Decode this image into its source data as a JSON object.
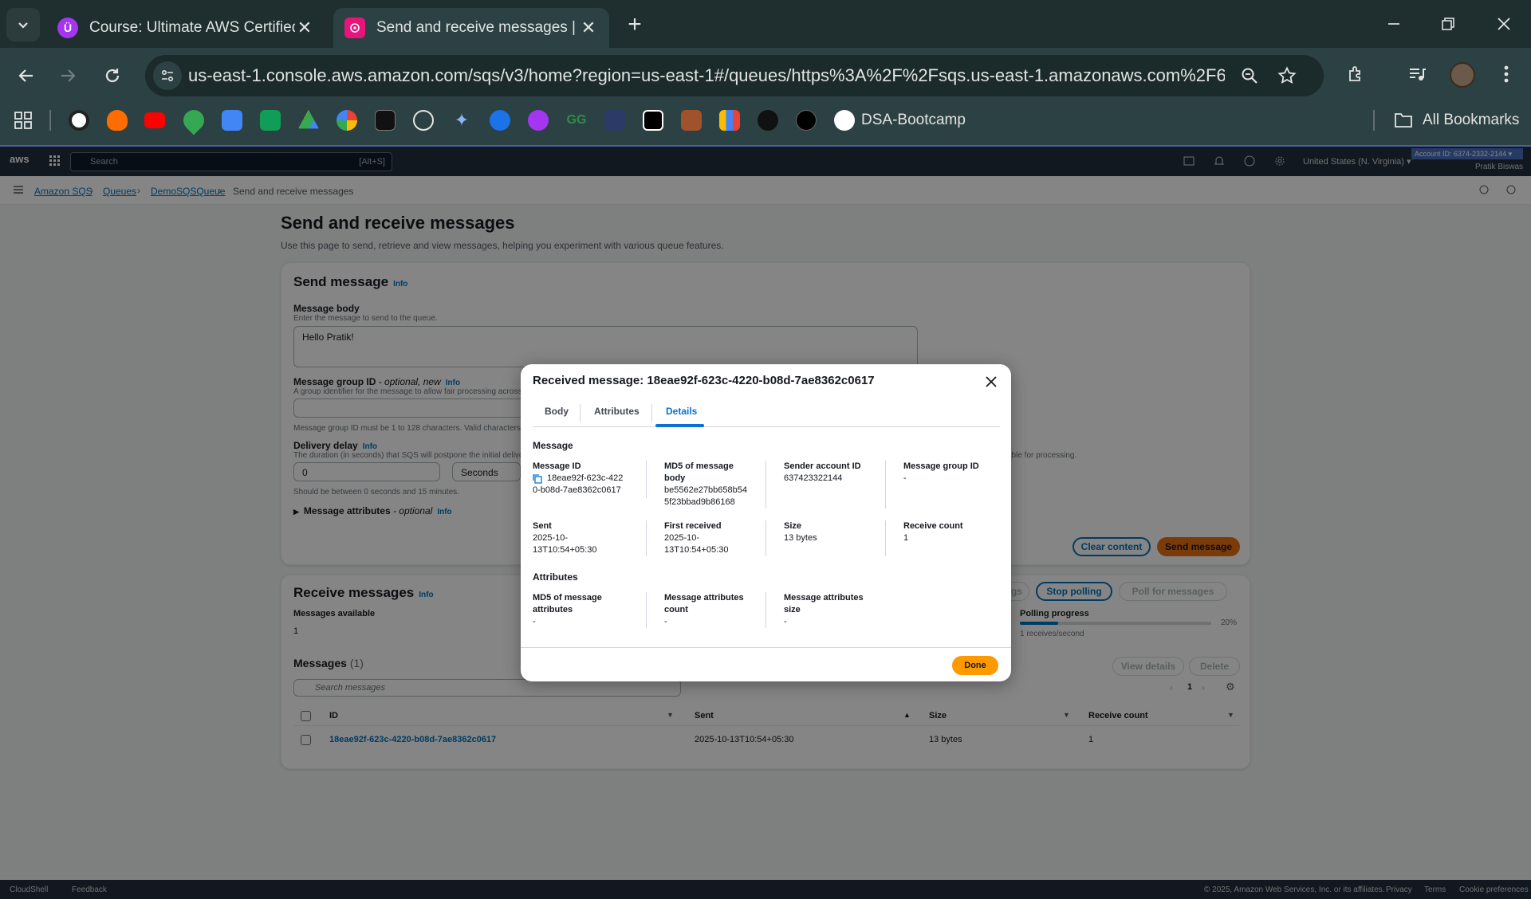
{
  "browser": {
    "tabs": [
      {
        "title": "Course: Ultimate AWS Certified",
        "favicon_color": "#a435f0"
      },
      {
        "title": "Send and receive messages | Sim",
        "favicon_color": "#e7157b"
      }
    ],
    "url": "us-east-1.console.aws.amazon.com/sqs/v3/home?region=us-east-1#/queues/https%3A%2F%2Fsqs.us-east-1.amazonaws.com%2F6374233...",
    "bookmark_label": "DSA-Bootcamp",
    "all_bookmarks": "All Bookmarks"
  },
  "aws": {
    "logo": "aws",
    "search_placeholder": "Search",
    "search_shortcut": "[Alt+S]",
    "region": "United States (N. Virginia) ▾",
    "account": "Account ID: 6374-2332-2144 ▾",
    "user": "Pratik Biswas"
  },
  "breadcrumb": [
    "Amazon SQS",
    "Queues",
    "DemoSQSQueue",
    "Send and receive messages"
  ],
  "page": {
    "title": "Send and receive messages",
    "description": "Use this page to send, retrieve and view messages, helping you experiment with various queue features."
  },
  "send": {
    "title": "Send message",
    "info": "Info",
    "body_label": "Message body",
    "body_desc": "Enter the message to send to the queue.",
    "body_value": "Hello Pratik!",
    "group_label": "Message group ID",
    "group_suffix": " - optional, new",
    "group_desc": "A group identifier for the message to allow fair processing across mes",
    "group_hint": "Message group ID must be 1 to 128 characters. Valid characters are a",
    "delay_label": "Delivery delay",
    "delay_desc": "The duration (in seconds) that SQS will postpone the initial delivery o",
    "delay_desc_right": "able for processing.",
    "delay_value": "0",
    "delay_unit": "Seconds",
    "delay_hint": "Should be between 0 seconds and 15 minutes.",
    "attrs": "Message attributes",
    "attrs_suffix": " - optional",
    "clear": "Clear content",
    "send_btn": "Send message"
  },
  "receive": {
    "title": "Receive messages",
    "info": "Info",
    "settings": "ttings",
    "stop": "Stop polling",
    "poll": "Poll for messages",
    "available_label": "Messages available",
    "available_value": "1",
    "progress_label": "Polling progress",
    "progress": 0.2,
    "progress_text": "20%",
    "rate": "1 receives/second"
  },
  "messages": {
    "title": "Messages",
    "count": "(1)",
    "view": "View details",
    "delete": "Delete",
    "search_placeholder": "Search messages",
    "page": "1",
    "columns": [
      "ID",
      "Sent",
      "Size",
      "Receive count"
    ],
    "rows": [
      {
        "id": "18eae92f-623c-4220-b08d-7ae8362c0617",
        "sent": "2025-10-13T10:54+05:30",
        "size": "13 bytes",
        "count": "1"
      }
    ]
  },
  "footer": {
    "cloudshell": "CloudShell",
    "feedback": "Feedback",
    "copyright": "© 2025, Amazon Web Services, Inc. or its affiliates.",
    "privacy": "Privacy",
    "terms": "Terms",
    "cookies": "Cookie preferences"
  },
  "modal": {
    "title": "Received message: 18eae92f-623c-4220-b08d-7ae8362c0617",
    "tabs": [
      "Body",
      "Attributes",
      "Details"
    ],
    "active_tab": "Details",
    "section_message": "Message",
    "section_attributes": "Attributes",
    "message_id_label": "Message ID",
    "message_id_line1": "18eae92f-623c-422",
    "message_id_line2": "0-b08d-7ae8362c0617",
    "md5_body_label1": "MD5 of message",
    "md5_body_label2": "body",
    "md5_body_line1": "be5562e27bb658b54",
    "md5_body_line2": "5f23bbad9b86168",
    "sender_label": "Sender account ID",
    "sender_value": "637423322144",
    "group_label": "Message group ID",
    "group_value": "-",
    "sent_label": "Sent",
    "sent_line1": "2025-10-",
    "sent_line2": "13T10:54+05:30",
    "first_label": "First received",
    "first_line1": "2025-10-",
    "first_line2": "13T10:54+05:30",
    "size_label": "Size",
    "size_value": "13 bytes",
    "rc_label": "Receive count",
    "rc_value": "1",
    "md5_attr_label1": "MD5 of message",
    "md5_attr_label2": "attributes",
    "md5_attr_value": "-",
    "attr_count_label1": "Message attributes",
    "attr_count_label2": "count",
    "attr_count_value": "-",
    "attr_size_label1": "Message attributes",
    "attr_size_label2": "size",
    "attr_size_value": "-",
    "done": "Done"
  }
}
